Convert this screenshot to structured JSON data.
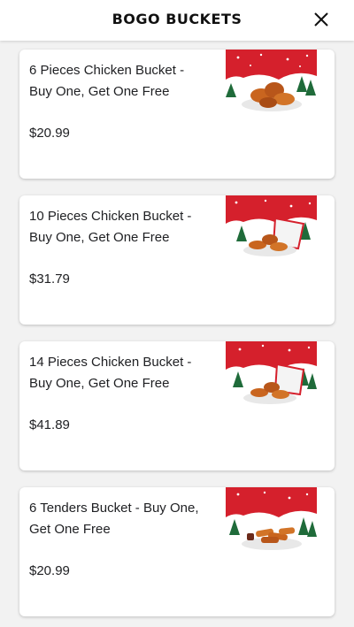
{
  "header": {
    "title": "BOGO BUCKETS",
    "close_icon": "close-icon"
  },
  "items": [
    {
      "name": "6 Pieces Chicken Bucket  - Buy One, Get One Free",
      "price": "$20.99",
      "image": "chicken-bucket-image"
    },
    {
      "name": "10 Pieces Chicken Bucket  - Buy One, Get One Free",
      "price": "$31.79",
      "image": "chicken-bucket-image"
    },
    {
      "name": "14 Pieces Chicken Bucket  - Buy One, Get One Free",
      "price": "$41.89",
      "image": "chicken-bucket-image"
    },
    {
      "name": "6 Tenders Bucket - Buy One, Get One Free",
      "price": "$20.99",
      "image": "tenders-image"
    }
  ],
  "colors": {
    "accent_red": "#d5202c",
    "background": "#f2f2f2",
    "card": "#ffffff"
  }
}
